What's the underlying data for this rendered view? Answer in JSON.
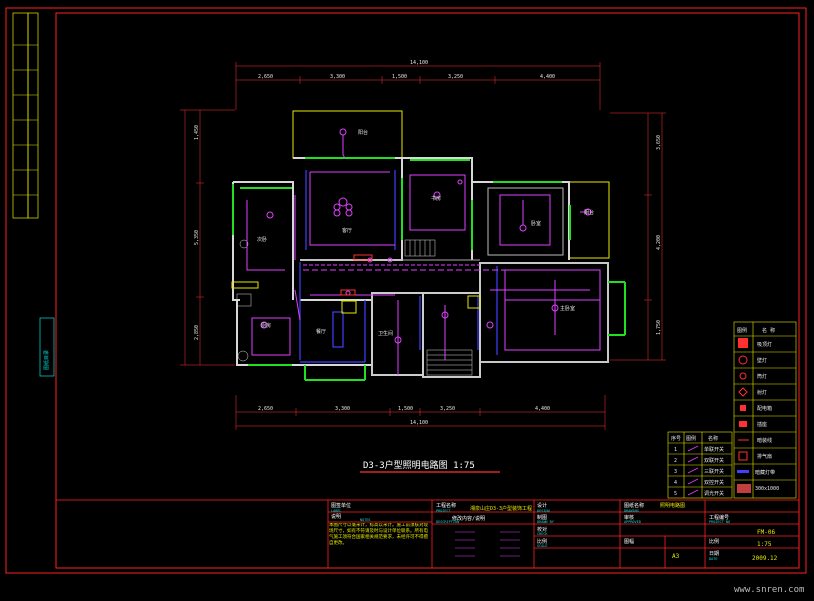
{
  "drawing": {
    "title": "D3-3户型照明电路图 1:75",
    "left_strip_label": "图纸目录"
  },
  "rooms": [
    {
      "id": "balcony",
      "label": "阳台"
    },
    {
      "id": "living",
      "label": "客厅"
    },
    {
      "id": "dining",
      "label": "餐厅"
    },
    {
      "id": "kitchen",
      "label": "厨房"
    },
    {
      "id": "study",
      "label": "书房"
    },
    {
      "id": "bedroom",
      "label": "卧室"
    },
    {
      "id": "master",
      "label": "主卧室"
    },
    {
      "id": "bath",
      "label": "卫生间"
    },
    {
      "id": "balcony2",
      "label": "阳台"
    },
    {
      "id": "room2",
      "label": "次卧"
    }
  ],
  "dimensions": {
    "overall": "14,100",
    "top_segments": [
      "2,650",
      "3,300",
      "1,500",
      "3,250",
      "4,400"
    ],
    "bottom_segments": [
      "2,650",
      "3,300",
      "1,500",
      "3,250",
      "4,400"
    ],
    "left": [
      "1,450",
      "5,350",
      "2,850"
    ],
    "right": [
      "3,650",
      "4,200",
      "1,750"
    ]
  },
  "legend": {
    "header": [
      "图例",
      "名 称"
    ],
    "rows": [
      {
        "icon": "ceiling-lamp",
        "name": "吸顶灯"
      },
      {
        "icon": "wall-lamp",
        "name": "壁灯"
      },
      {
        "icon": "spot",
        "name": "筒灯"
      },
      {
        "icon": "downlight",
        "name": "射灯"
      },
      {
        "icon": "switch-box",
        "name": "配电箱"
      },
      {
        "icon": "socket",
        "name": "插座"
      },
      {
        "icon": "dim-line",
        "name": "暗装线"
      },
      {
        "icon": "fan",
        "name": "排气扇"
      },
      {
        "icon": "bar",
        "name": "暗藏灯带"
      },
      {
        "icon": "panel",
        "name": "300x1000"
      }
    ]
  },
  "switch_table": {
    "header": [
      "序号",
      "图例",
      "名称"
    ],
    "rows": [
      {
        "no": "1",
        "name": "单联开关"
      },
      {
        "no": "2",
        "name": "双联开关"
      },
      {
        "no": "3",
        "name": "三联开关"
      },
      {
        "no": "4",
        "name": "双控开关"
      },
      {
        "no": "5",
        "name": "调光开关"
      }
    ]
  },
  "title_block": {
    "seal_label": "图签单位",
    "seal_sub": "LABEL",
    "note_title": "说明",
    "note_sub": "NOTES",
    "notes": "本图尺寸以毫米计，标高以米计。施工前须核对现场尺寸，如有不符请及时与设计单位联系。所有电气施工须符合国家相关规范要求，未经许可不得擅自更改。",
    "project_label": "工程名称",
    "project_sub": "PROJECT",
    "project_name": "湘泉山庄D3-3户型装饰工程",
    "rev_label": "修改内容/说明",
    "rev_sub": "DESCRIPTION",
    "design_label": "设计",
    "design_sub": "DESIGN",
    "draw_label": "制图",
    "draw_sub": "DRAWN BY",
    "check_label": "校对",
    "check_sub": "CHECK",
    "scale_label": "比例",
    "scale_sub": "SCALE",
    "sheet_label": "图纸名称",
    "sheet_sub": "DRAWING",
    "sheet_name": "照明电路图",
    "review_label": "审核",
    "review_sub": "APPROVED",
    "size_label": "图幅",
    "size_value": "A3",
    "no_label": "工程编号",
    "no_sub": "PROJECT NO",
    "no_value": "FM-06",
    "ratio_label": "比例",
    "ratio_value": "1:75",
    "date_label": "日期",
    "date_sub": "DATE",
    "date_value": "2009.12"
  },
  "watermark": "www.snren.com",
  "colors": {
    "frame": "#ff2020",
    "wall": "#e0e0e0",
    "circuit": "#e040ff",
    "window": "#20e020",
    "yellow": "#e8e800",
    "cyan": "#00e0e0",
    "blue": "#4040ff"
  }
}
